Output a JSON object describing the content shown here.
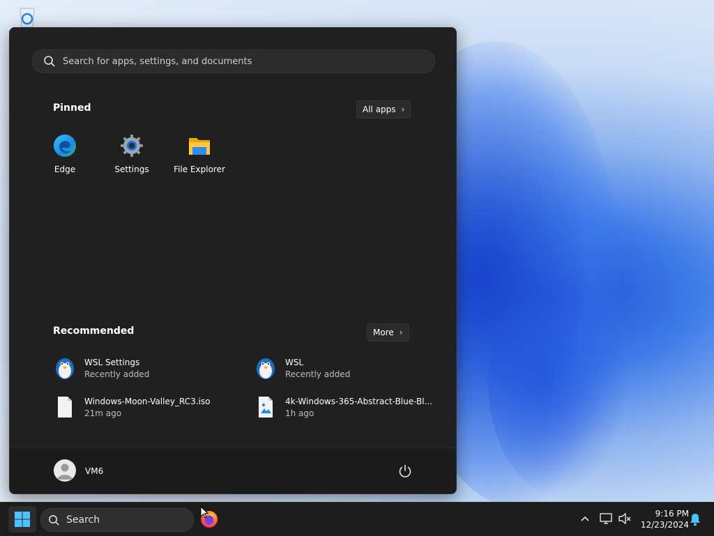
{
  "start_menu": {
    "search_placeholder": "Search for apps, settings, and documents",
    "pinned_title": "Pinned",
    "all_apps_label": "All apps",
    "pinned": [
      {
        "label": "Edge",
        "icon": "edge-icon"
      },
      {
        "label": "Settings",
        "icon": "settings-gear-icon"
      },
      {
        "label": "File Explorer",
        "icon": "folder-icon"
      }
    ],
    "recommended_title": "Recommended",
    "more_label": "More",
    "recommended": [
      {
        "name": "WSL Settings",
        "meta": "Recently added",
        "icon": "penguin-icon"
      },
      {
        "name": "WSL",
        "meta": "Recently added",
        "icon": "penguin-icon"
      },
      {
        "name": "Windows-Moon-Valley_RC3.iso",
        "meta": "21m ago",
        "icon": "file-icon"
      },
      {
        "name": "4k-Windows-365-Abstract-Blue-Bl...",
        "meta": "1h ago",
        "icon": "image-file-icon"
      }
    ],
    "user_name": "VM6"
  },
  "taskbar": {
    "search_placeholder": "Search",
    "time": "9:16 PM",
    "date": "12/23/2024"
  },
  "colors": {
    "menu_bg": "#202020",
    "taskbar_bg": "#1c1c1c",
    "accent": "#4cc2ff"
  }
}
